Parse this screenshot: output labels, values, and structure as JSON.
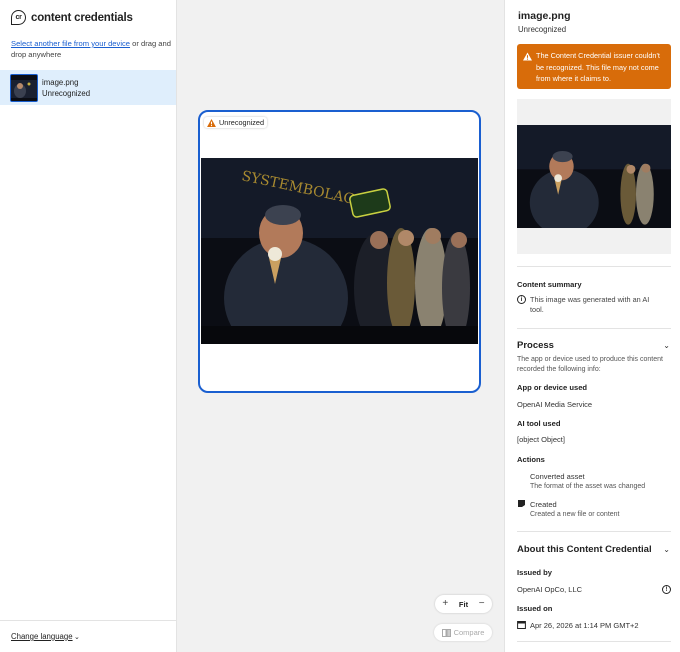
{
  "brand": {
    "logo_text": "cr",
    "name": "content credentials"
  },
  "sidebar": {
    "upload_link": "Select another file from your device",
    "upload_rest": " or drag and drop anywhere",
    "file": {
      "name": "image.png",
      "status": "Unrecognized"
    },
    "language_link": "Change language"
  },
  "canvas": {
    "badge": "Unrecognized",
    "zoom_fit": "Fit",
    "compare": "Compare"
  },
  "panel": {
    "title": "image.png",
    "subtitle": "Unrecognized",
    "alert": "The Content Credential issuer couldn't be recognized. This file may not come from where it claims to.",
    "content_summary": {
      "heading": "Content summary",
      "text": "This image was generated with an AI tool."
    },
    "process": {
      "heading": "Process",
      "description": "The app or device used to produce this content recorded the following info:",
      "app_label": "App or device used",
      "app_value": "OpenAI Media Service",
      "ai_tool_label": "AI tool used",
      "ai_tool_value": "[object Object]",
      "actions_label": "Actions",
      "actions": [
        {
          "title": "Converted asset",
          "desc": "The format of the asset was changed"
        },
        {
          "title": "Created",
          "desc": "Created a new file or content"
        }
      ]
    },
    "about": {
      "heading": "About this Content Credential",
      "issued_by_label": "Issued by",
      "issued_by_value": "OpenAI OpCo, LLC",
      "issued_on_label": "Issued on",
      "issued_on_value": "Apr 26, 2026 at 1:14 PM GMT+2"
    }
  },
  "colors": {
    "accent": "#1a5fd0",
    "warning": "#d86c0a",
    "selected_bg": "#dfeefc",
    "canvas_bg": "#f1f1f1"
  },
  "icons": [
    "warning-icon",
    "info-icon",
    "chevron-down-icon",
    "plus-icon",
    "minus-icon",
    "compare-icon",
    "calendar-icon",
    "action-icon"
  ]
}
